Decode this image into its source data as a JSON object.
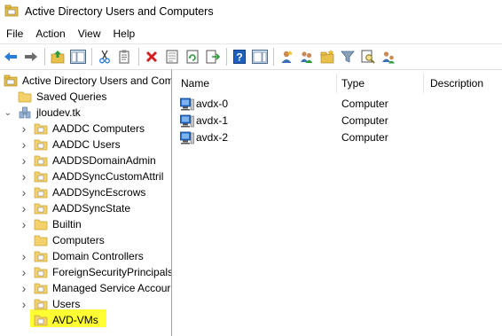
{
  "window": {
    "title": "Active Directory Users and Computers"
  },
  "menu": [
    "File",
    "Action",
    "View",
    "Help"
  ],
  "toolbar": {
    "icons": [
      "back-arrow-icon",
      "forward-arrow-icon",
      "up-folder-icon",
      "show-console-tree-icon",
      "cut-icon",
      "copy-icon",
      "delete-icon",
      "properties-icon",
      "refresh-icon",
      "export-list-icon",
      "help-icon",
      "action-pane-icon",
      "new-user-icon",
      "new-group-icon",
      "new-ou-icon",
      "filter-icon",
      "find-icon",
      "add-to-group-icon"
    ]
  },
  "tree": {
    "root": "Active Directory Users and Com",
    "saved_queries": "Saved Queries",
    "domain": "jloudev.tk",
    "items": [
      {
        "label": "AADDC Computers",
        "expandable": true
      },
      {
        "label": "AADDC Users",
        "expandable": true
      },
      {
        "label": "AADDSDomainAdmin",
        "expandable": true
      },
      {
        "label": "AADDSyncCustomAttril",
        "expandable": true
      },
      {
        "label": "AADDSyncEscrows",
        "expandable": true
      },
      {
        "label": "AADDSyncState",
        "expandable": true
      },
      {
        "label": "Builtin",
        "expandable": true
      },
      {
        "label": "Computers",
        "expandable": false
      },
      {
        "label": "Domain Controllers",
        "expandable": true
      },
      {
        "label": "ForeignSecurityPrincipals",
        "expandable": true
      },
      {
        "label": "Managed Service Accour",
        "expandable": true
      },
      {
        "label": "Users",
        "expandable": true
      },
      {
        "label": "AVD-VMs",
        "expandable": false,
        "highlighted": true
      }
    ]
  },
  "list": {
    "columns": [
      "Name",
      "Type",
      "Description"
    ],
    "rows": [
      {
        "name": "avdx-0",
        "type": "Computer",
        "description": ""
      },
      {
        "name": "avdx-1",
        "type": "Computer",
        "description": ""
      },
      {
        "name": "avdx-2",
        "type": "Computer",
        "description": ""
      }
    ]
  },
  "colors": {
    "highlight": "#ffff33",
    "folder": "#e8c04a",
    "accent_blue": "#1e6fd0"
  }
}
